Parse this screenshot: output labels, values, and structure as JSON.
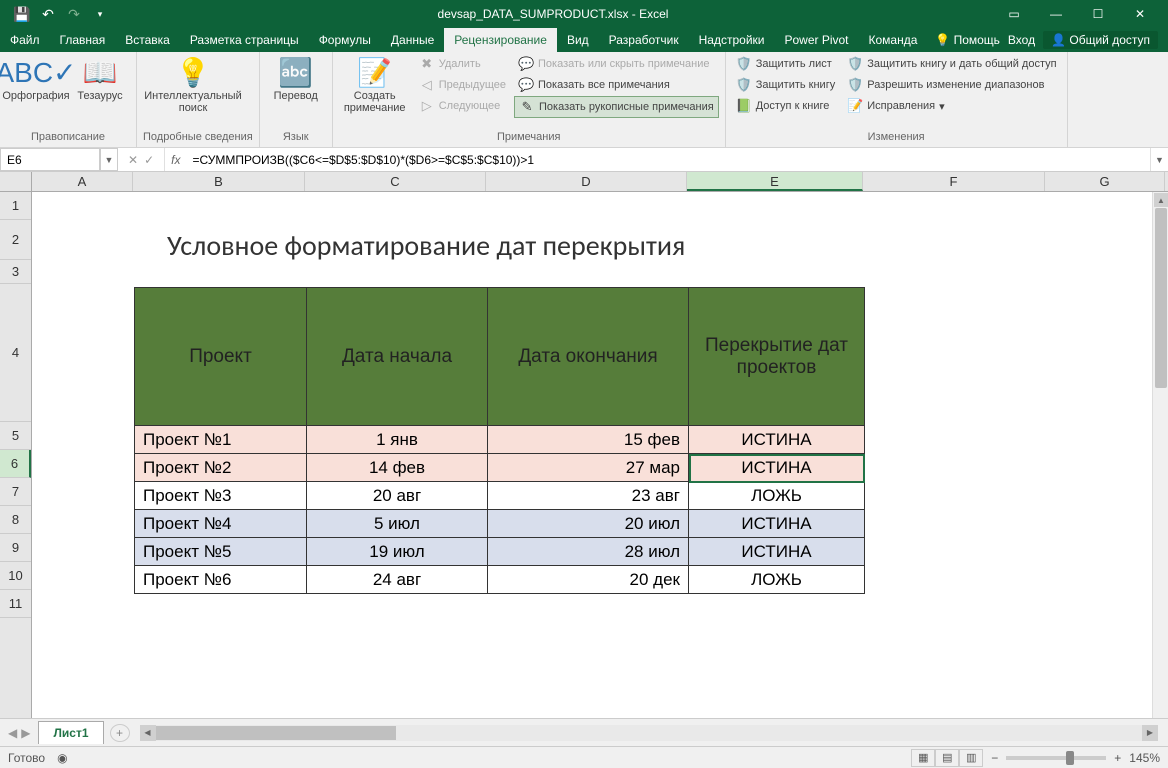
{
  "app": {
    "title": "devsap_DATA_SUMPRODUCT.xlsx - Excel"
  },
  "tabs": {
    "file": "Файл",
    "home": "Главная",
    "insert": "Вставка",
    "pagelayout": "Разметка страницы",
    "formulas": "Формулы",
    "data": "Данные",
    "review": "Рецензирование",
    "view": "Вид",
    "developer": "Разработчик",
    "addins": "Надстройки",
    "powerpivot": "Power Pivot",
    "team": "Команда",
    "help": "Помощь",
    "signin": "Вход",
    "share": "Общий доступ"
  },
  "ribbon": {
    "spelling": "Орфография",
    "thesaurus": "Тезаурус",
    "group_proofing": "Правописание",
    "smart_lookup": "Интеллектуальный поиск",
    "group_insights": "Подробные сведения",
    "translate": "Перевод",
    "group_language": "Язык",
    "new_comment": "Создать примечание",
    "delete": "Удалить",
    "previous": "Предыдущее",
    "next": "Следующее",
    "show_hide": "Показать или скрыть примечание",
    "show_all": "Показать все примечания",
    "show_ink": "Показать рукописные примечания",
    "group_comments": "Примечания",
    "protect_sheet": "Защитить лист",
    "protect_book": "Защитить книгу",
    "share_book": "Доступ к книге",
    "protect_share": "Защитить книгу и дать общий доступ",
    "allow_ranges": "Разрешить изменение диапазонов",
    "track_changes": "Исправления",
    "group_changes": "Изменения"
  },
  "formula": {
    "cell_ref": "E6",
    "value": "=СУММПРОИЗВ(($C6<=$D$5:$D$10)*($D6>=$C$5:$C$10))>1"
  },
  "columns": [
    "A",
    "B",
    "C",
    "D",
    "E",
    "F",
    "G"
  ],
  "rows": [
    "1",
    "2",
    "3",
    "4",
    "5",
    "6",
    "7",
    "8",
    "9",
    "10",
    "11"
  ],
  "sheet": {
    "title": "Условное форматирование дат перекрытия",
    "headers": {
      "project": "Проект",
      "start": "Дата начала",
      "end": "Дата окончания",
      "overlap": "Перекрытие дат проектов"
    },
    "data": [
      {
        "name": "Проект №1",
        "start": "1 янв",
        "end": "15 фев",
        "overlap": "ИСТИНА",
        "fmt": "pink"
      },
      {
        "name": "Проект №2",
        "start": "14 фев",
        "end": "27 мар",
        "overlap": "ИСТИНА",
        "fmt": "pink"
      },
      {
        "name": "Проект №3",
        "start": "20 авг",
        "end": "23 авг",
        "overlap": "ЛОЖЬ",
        "fmt": "white"
      },
      {
        "name": "Проект №4",
        "start": "5 июл",
        "end": "20 июл",
        "overlap": "ИСТИНА",
        "fmt": "blue"
      },
      {
        "name": "Проект №5",
        "start": "19 июл",
        "end": "28 июл",
        "overlap": "ИСТИНА",
        "fmt": "blue"
      },
      {
        "name": "Проект №6",
        "start": "24 авг",
        "end": "20 дек",
        "overlap": "ЛОЖЬ",
        "fmt": "white"
      }
    ]
  },
  "sheet_tab": "Лист1",
  "status": {
    "ready": "Готово",
    "zoom": "145%"
  }
}
